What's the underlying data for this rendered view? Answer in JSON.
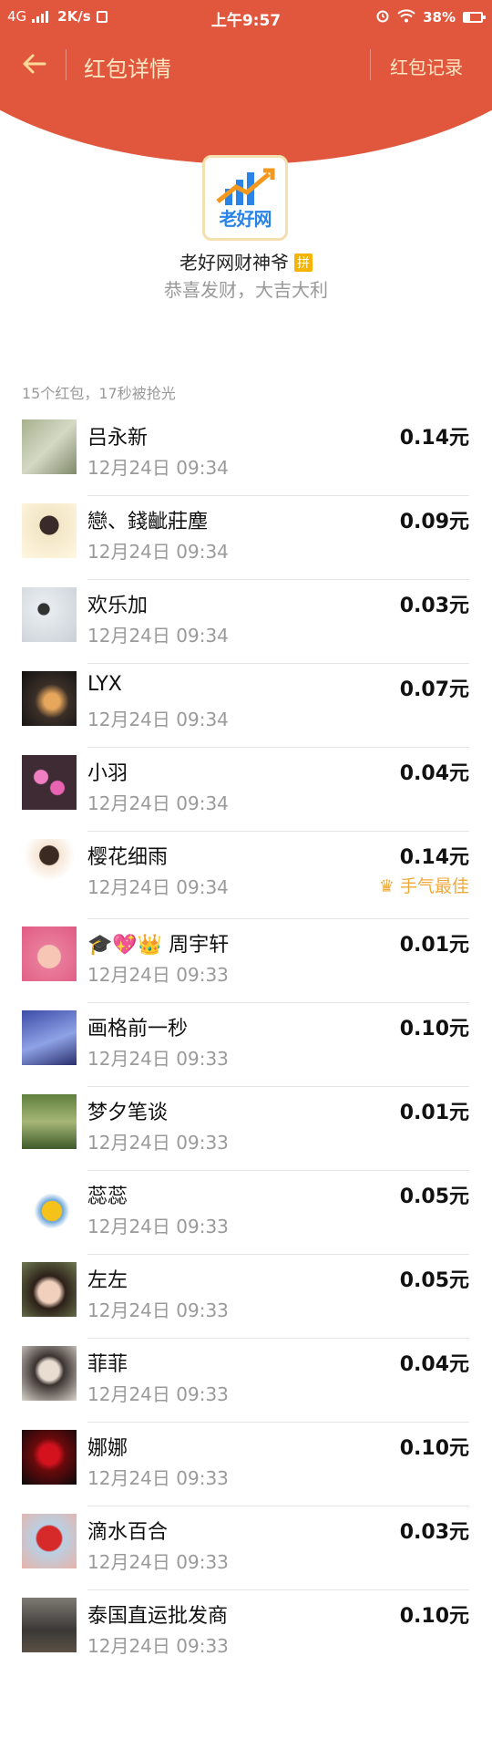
{
  "status_bar": {
    "network": "4G",
    "speed": "2K/s",
    "time": "上午9:57",
    "battery": "38%"
  },
  "nav": {
    "title": "红包详情",
    "records": "红包记录"
  },
  "sender": {
    "logo_text": "老好网",
    "name": "老好网财神爷",
    "badge": "拼",
    "blessing": "恭喜发财，大吉大利"
  },
  "summary": "15个红包，17秒被抢光",
  "colors": {
    "header_red": "#e0573e",
    "best_luck": "#f0a93c"
  },
  "entries": [
    {
      "name": "吕永新",
      "time": "12月24日  09:34",
      "amount": "0.14元"
    },
    {
      "name": "戀、錢齜莊塵",
      "time": "12月24日  09:34",
      "amount": "0.09元"
    },
    {
      "name": "欢乐加",
      "time": "12月24日  09:34",
      "amount": "0.03元"
    },
    {
      "name": "LYX",
      "time": "12月24日  09:34",
      "amount": "0.07元"
    },
    {
      "name": "小羽",
      "time": "12月24日  09:34",
      "amount": "0.04元"
    },
    {
      "name": "樱花细雨",
      "time": "12月24日  09:34",
      "amount": "0.14元",
      "best": "手气最佳"
    },
    {
      "name": "🎓💖👑 周宇轩",
      "time": "12月24日  09:33",
      "amount": "0.01元"
    },
    {
      "name": "画格前一秒",
      "time": "12月24日  09:33",
      "amount": "0.10元"
    },
    {
      "name": "梦夕笔谈",
      "time": "12月24日  09:33",
      "amount": "0.01元"
    },
    {
      "name": "蕊蕊",
      "time": "12月24日  09:33",
      "amount": "0.05元"
    },
    {
      "name": "左左",
      "time": "12月24日  09:33",
      "amount": "0.05元"
    },
    {
      "name": "菲菲",
      "time": "12月24日  09:33",
      "amount": "0.04元"
    },
    {
      "name": "娜娜",
      "time": "12月24日  09:33",
      "amount": "0.10元"
    },
    {
      "name": "滴水百合",
      "time": "12月24日  09:33",
      "amount": "0.03元"
    },
    {
      "name": "泰国直运批发商",
      "time": "12月24日  09:33",
      "amount": "0.10元"
    }
  ]
}
